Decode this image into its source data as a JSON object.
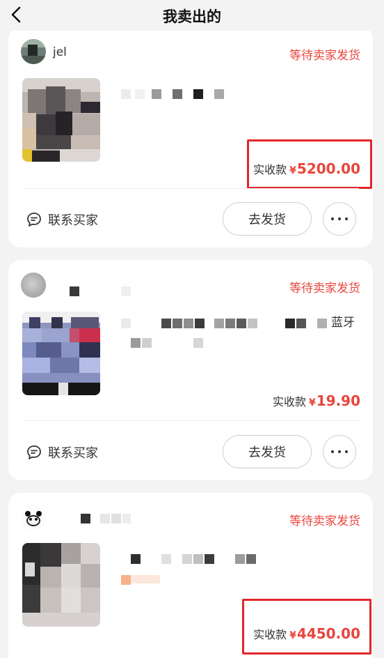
{
  "header": {
    "title": "我卖出的",
    "back_icon": "back-arrow-icon"
  },
  "colors": {
    "accent": "#e8453c",
    "highlight_box": "#e3262b",
    "background": "#f3f3f3"
  },
  "orders": [
    {
      "buyer_name": "jel",
      "status": "等待卖家发货",
      "amount_label": "实收款",
      "currency": "¥",
      "amount": "5200.00",
      "contact_label": "联系买家",
      "ship_label": "去发货"
    },
    {
      "buyer_name": "",
      "status": "等待卖家发货",
      "product_title_tail": "蓝牙",
      "amount_label": "实收款",
      "currency": "¥",
      "amount": "19.90",
      "contact_label": "联系买家",
      "ship_label": "去发货"
    },
    {
      "buyer_name": "",
      "status": "等待卖家发货",
      "amount_label": "实收款",
      "currency": "¥",
      "amount": "4450.00"
    }
  ]
}
